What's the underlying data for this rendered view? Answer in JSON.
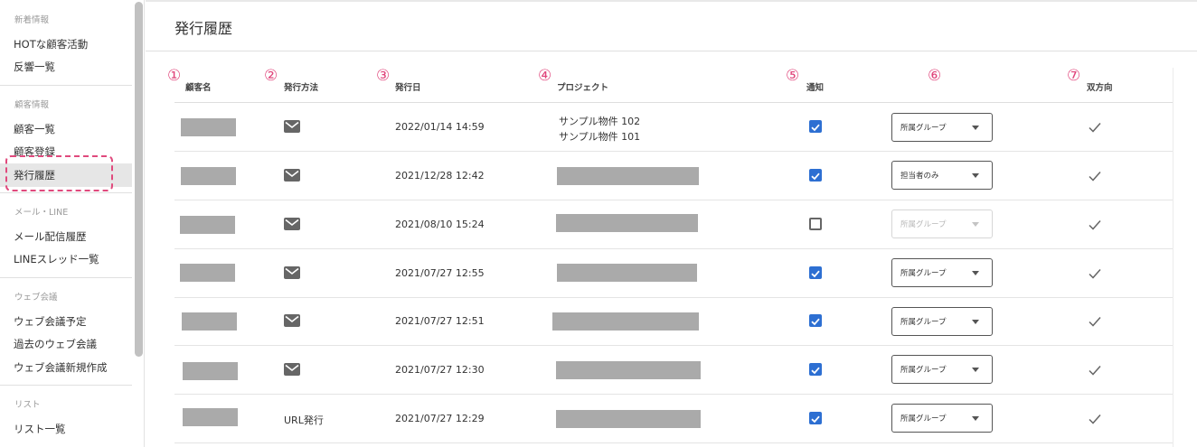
{
  "sidebar": {
    "sections": [
      {
        "header": "新着情報",
        "items": [
          {
            "label": "HOTな顧客活動"
          },
          {
            "label": "反響一覧"
          }
        ]
      },
      {
        "header": "顧客情報",
        "items": [
          {
            "label": "顧客一覧"
          },
          {
            "label": "顧客登録"
          },
          {
            "label": "発行履歴",
            "active": true
          }
        ]
      },
      {
        "header": "メール・LINE",
        "items": [
          {
            "label": "メール配信履歴"
          },
          {
            "label": "LINEスレッド一覧"
          }
        ]
      },
      {
        "header": "ウェブ会議",
        "items": [
          {
            "label": "ウェブ会議予定"
          },
          {
            "label": "過去のウェブ会議"
          },
          {
            "label": "ウェブ会議新規作成"
          }
        ]
      },
      {
        "header": "リスト",
        "items": [
          {
            "label": "リスト一覧"
          }
        ]
      }
    ]
  },
  "page": {
    "title": "発行履歴"
  },
  "table": {
    "columns": [
      {
        "num": "①",
        "label": "顧客名"
      },
      {
        "num": "②",
        "label": "発行方法"
      },
      {
        "num": "③",
        "label": "発行日"
      },
      {
        "num": "④",
        "label": "プロジェクト"
      },
      {
        "num": "⑤",
        "label": "通知"
      },
      {
        "num": "⑥",
        "label": ""
      },
      {
        "num": "⑦",
        "label": "双方向"
      }
    ],
    "rows": [
      {
        "method_icon": "mail-icon",
        "method_text": "",
        "date": "2022/01/14 14:59",
        "projects": [
          "サンプル物件 102",
          "サンプル物件 101"
        ],
        "notify": true,
        "group": "所属グループ",
        "group_disabled": false,
        "bidirectional_icon": "check-icon"
      },
      {
        "method_icon": "mail-icon",
        "method_text": "",
        "date": "2021/12/28 12:42",
        "projects": [],
        "notify": true,
        "group": "担当者のみ",
        "group_disabled": false,
        "bidirectional_icon": "check-icon"
      },
      {
        "method_icon": "mail-icon",
        "method_text": "",
        "date": "2021/08/10 15:24",
        "projects": [],
        "notify": false,
        "group": "所属グループ",
        "group_disabled": true,
        "bidirectional_icon": "check-icon"
      },
      {
        "method_icon": "mail-icon",
        "method_text": "",
        "date": "2021/07/27 12:55",
        "projects": [],
        "notify": true,
        "group": "所属グループ",
        "group_disabled": false,
        "bidirectional_icon": "check-icon"
      },
      {
        "method_icon": "mail-icon",
        "method_text": "",
        "date": "2021/07/27 12:51",
        "projects": [],
        "notify": true,
        "group": "所属グループ",
        "group_disabled": false,
        "bidirectional_icon": "check-icon"
      },
      {
        "method_icon": "mail-icon",
        "method_text": "",
        "date": "2021/07/27 12:30",
        "projects": [],
        "notify": true,
        "group": "所属グループ",
        "group_disabled": false,
        "bidirectional_icon": "check-icon"
      },
      {
        "method_icon": "",
        "method_text": "URL発行",
        "date": "2021/07/27 12:29",
        "projects": [],
        "notify": true,
        "group": "所属グループ",
        "group_disabled": false,
        "bidirectional_icon": "check-icon"
      }
    ]
  },
  "colors": {
    "accent": "#e0457b",
    "checkbox_on": "#2d6fd2",
    "redaction": "#aaaaaa",
    "active_item_bg": "#e6e6e6"
  }
}
